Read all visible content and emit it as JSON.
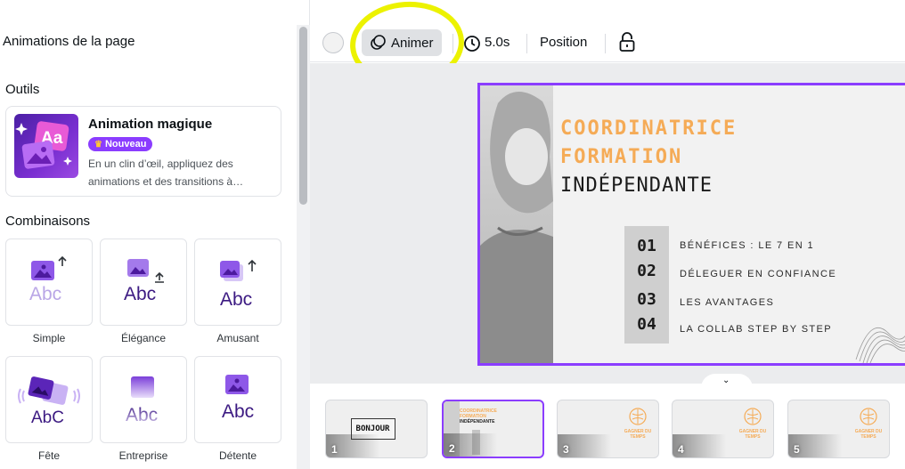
{
  "left_panel": {
    "title": "Animations de la page",
    "tools_heading": "Outils",
    "magic": {
      "title": "Animation magique",
      "badge": "Nouveau",
      "desc": "En un clin d’œil, appliquez des animations et des transitions à…",
      "thumb_text": "Aa"
    },
    "combos_heading": "Combinaisons",
    "combos": [
      {
        "label": "Simple",
        "glyph": "Abc"
      },
      {
        "label": "Élégance",
        "glyph": "Abc"
      },
      {
        "label": "Amusant",
        "glyph": "Abc"
      },
      {
        "label": "Fête",
        "glyph": "AbC"
      },
      {
        "label": "Entreprise",
        "glyph": "Abc"
      },
      {
        "label": "Détente",
        "glyph": "Abc"
      }
    ]
  },
  "toolbar": {
    "animate_label": "Animer",
    "duration": "5.0s",
    "position_label": "Position"
  },
  "slide": {
    "title_line1": "COORDINATRICE",
    "title_line2": "FORMATION",
    "title_line3": "INDÉPENDANTE",
    "items": [
      {
        "num": "01",
        "text": "BÉNÉFICES : LE 7 EN 1"
      },
      {
        "num": "02",
        "text": "DÉLEGUER EN CONFIANCE"
      },
      {
        "num": "03",
        "text": "LES AVANTAGES"
      },
      {
        "num": "04",
        "text": "LA COLLAB STEP BY STEP"
      }
    ]
  },
  "filmstrip": {
    "pages": [
      "1",
      "2",
      "3",
      "4",
      "5"
    ],
    "page1_text": "BONJOUR",
    "page3_text": "GAGNER DU TEMPS",
    "page4_text": "GAGNER DU TEMPS",
    "page5_text": "GAGNER DU TEMPS",
    "selected_page": "2"
  },
  "colors": {
    "accent": "#8b3dff",
    "highlight": "#ecf200",
    "slide_orange": "#f5ab56"
  }
}
